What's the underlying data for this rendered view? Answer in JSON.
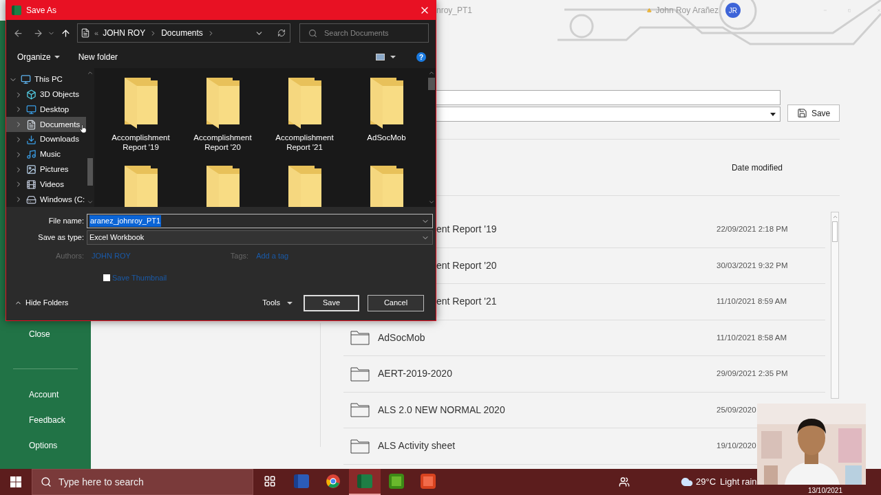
{
  "excel": {
    "title_fragment": "nroy_PT1",
    "user_name": "John Roy Arañez",
    "user_initials": "JR",
    "sidebar": [
      {
        "kind": "item",
        "label": "Close"
      },
      {
        "kind": "separator"
      },
      {
        "kind": "item",
        "label": "Account"
      },
      {
        "kind": "item",
        "label": "Feedback"
      },
      {
        "kind": "item",
        "label": "Options"
      }
    ],
    "save_button": "Save",
    "column_header": "Date modified",
    "files_under_dialog": [
      {
        "name": "ent Report '19",
        "date": "22/09/2021 2:18 PM"
      },
      {
        "name": "ent Report '20",
        "date": "30/03/2021 9:32 PM"
      },
      {
        "name": "ent Report '21",
        "date": "11/10/2021 8:59 AM"
      }
    ],
    "files": [
      {
        "name": "AdSocMob",
        "date": "11/10/2021 8:58 AM"
      },
      {
        "name": "AERT-2019-2020",
        "date": "29/09/2021 2:35 PM"
      },
      {
        "name": "ALS 2.0 NEW NORMAL 2020",
        "date": "25/09/2020"
      },
      {
        "name": "ALS Activity sheet",
        "date": "19/10/2020"
      }
    ]
  },
  "dialog": {
    "title": "Save As",
    "address_overflow": "«",
    "address": [
      "JOHN ROY",
      "Documents"
    ],
    "help": "?",
    "search_placeholder": "Search Documents",
    "organize": "Organize",
    "new_folder": "New folder",
    "tree": [
      {
        "label": "This PC",
        "kind": "pc",
        "expanded": true,
        "selected": false,
        "children": [
          {
            "label": "3D Objects",
            "kind": "objects",
            "expanded": false,
            "selected": false
          },
          {
            "label": "Desktop",
            "kind": "desktop",
            "expanded": false,
            "selected": false
          },
          {
            "label": "Documents",
            "kind": "documents",
            "expanded": false,
            "selected": true
          },
          {
            "label": "Downloads",
            "kind": "downloads",
            "expanded": false,
            "selected": false
          },
          {
            "label": "Music",
            "kind": "music",
            "expanded": false,
            "selected": false
          },
          {
            "label": "Pictures",
            "kind": "pictures",
            "expanded": false,
            "selected": false
          },
          {
            "label": "Videos",
            "kind": "videos",
            "expanded": false,
            "selected": false
          },
          {
            "label": "Windows (C:",
            "kind": "drive",
            "expanded": false,
            "selected": false
          }
        ]
      }
    ],
    "folders": [
      {
        "kind": "folder",
        "label": "Accomplishment Report '19"
      },
      {
        "kind": "folder",
        "label": "Accomplishment Report '20"
      },
      {
        "kind": "folder",
        "label": "Accomplishment Report '21"
      },
      {
        "kind": "folder",
        "label": "AdSocMob"
      },
      {
        "kind": "folder"
      },
      {
        "kind": "folder"
      },
      {
        "kind": "folder"
      },
      {
        "kind": "folder"
      }
    ],
    "file_name_label": "File name:",
    "file_name": "aranez_johnroy_PT1",
    "file_name_highlighted": true,
    "type_label": "Save as type:",
    "save_type": "Excel Workbook",
    "authors_label": "Authors:",
    "authors": "JOHN ROY",
    "tags_label": "Tags:",
    "tags_link": "Add a tag",
    "thumbnail": {
      "label": "Save Thumbnail",
      "checked": false
    },
    "hide_folders": "Hide Folders",
    "tools": "Tools",
    "save": "Save",
    "cancel": "Cancel"
  },
  "taskbar": {
    "search_placeholder": "Type here to search",
    "apps": [
      {
        "kind": "taskview",
        "active": false
      },
      {
        "kind": "word",
        "active": false
      },
      {
        "kind": "chrome",
        "active": false
      },
      {
        "kind": "excel",
        "active": true
      },
      {
        "kind": "camtasia_green",
        "active": false
      },
      {
        "kind": "camtasia_red",
        "active": false
      }
    ],
    "temperature": "29°C",
    "weather": "Light rain",
    "date": "13/10/2021"
  }
}
